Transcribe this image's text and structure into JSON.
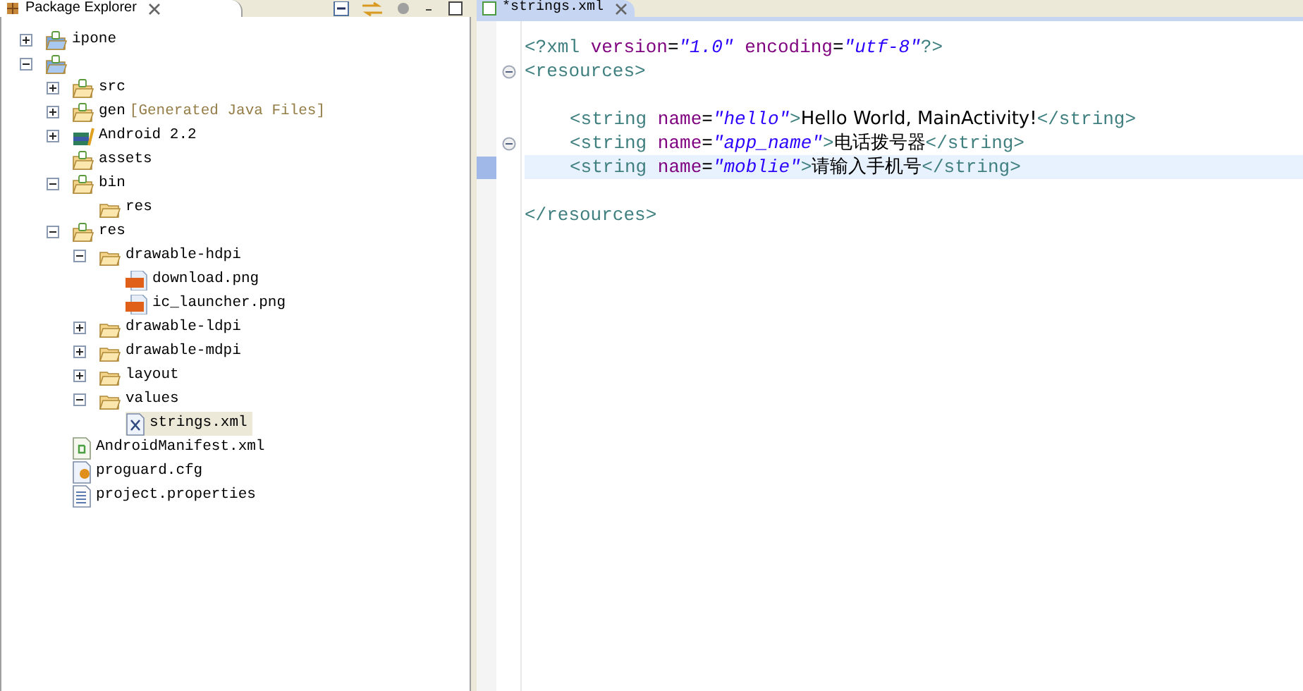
{
  "explorer": {
    "title": "Package Explorer",
    "tree": [
      {
        "label": "ipone",
        "kind": "project",
        "expanded": false,
        "selected": false
      },
      {
        "kind": "project",
        "expanded": true,
        "selected": false,
        "children": [
          {
            "label": "src",
            "kind": "source-folder",
            "expanded": false,
            "selected": false
          },
          {
            "label": "gen",
            "decoration": "[Generated Java Files]",
            "kind": "source-folder",
            "expanded": false,
            "selected": false
          },
          {
            "label": "Android 2.2",
            "kind": "library",
            "expanded": false,
            "selected": false
          },
          {
            "label": "assets",
            "kind": "source-folder",
            "selected": false
          },
          {
            "label": "bin",
            "kind": "source-folder",
            "expanded": true,
            "selected": false,
            "children": [
              {
                "label": "res",
                "kind": "folder",
                "selected": false
              }
            ]
          },
          {
            "label": "res",
            "kind": "source-folder",
            "expanded": true,
            "selected": false,
            "children": [
              {
                "label": "drawable-hdpi",
                "kind": "folder",
                "expanded": true,
                "selected": false,
                "children": [
                  {
                    "label": "download.png",
                    "kind": "png",
                    "selected": false
                  },
                  {
                    "label": "ic_launcher.png",
                    "kind": "png",
                    "selected": false
                  }
                ]
              },
              {
                "label": "drawable-ldpi",
                "kind": "folder",
                "expanded": false,
                "selected": false
              },
              {
                "label": "drawable-mdpi",
                "kind": "folder",
                "expanded": false,
                "selected": false
              },
              {
                "label": "layout",
                "kind": "folder",
                "expanded": false,
                "selected": false
              },
              {
                "label": "values",
                "kind": "folder",
                "expanded": true,
                "selected": false,
                "children": [
                  {
                    "label": "strings.xml",
                    "kind": "xml",
                    "selected": true
                  }
                ]
              }
            ]
          },
          {
            "label": "AndroidManifest.xml",
            "kind": "manifest",
            "selected": false
          },
          {
            "label": "proguard.cfg",
            "kind": "cfg",
            "selected": false
          },
          {
            "label": "project.properties",
            "kind": "properties",
            "selected": false
          }
        ]
      }
    ]
  },
  "editor": {
    "tab": {
      "title": "*strings.xml",
      "selected": true
    },
    "lines": [
      {
        "fold": false,
        "current": false,
        "indented": false,
        "tokens": [
          {
            "kind": "tag",
            "text": "<?xml"
          },
          {
            "kind": "attr",
            "text": " version"
          },
          {
            "kind": "punct",
            "text": "="
          },
          {
            "kind": "value",
            "text": "\"1.0\""
          },
          {
            "kind": "attr",
            "text": " encoding"
          },
          {
            "kind": "punct",
            "text": "="
          },
          {
            "kind": "value",
            "text": "\"utf-8\""
          },
          {
            "kind": "tag",
            "text": "?>"
          }
        ]
      },
      {
        "fold": true,
        "current": false,
        "indented": false,
        "tokens": [
          {
            "kind": "tag",
            "text": "<resources>"
          }
        ]
      },
      {
        "fold": false,
        "current": false
      },
      {
        "fold": false,
        "current": false,
        "indented": true,
        "tokens": [
          {
            "kind": "tag",
            "text": "<string"
          },
          {
            "kind": "attr",
            "text": " name"
          },
          {
            "kind": "punct",
            "text": "="
          },
          {
            "kind": "value",
            "text": "\"hello\""
          },
          {
            "kind": "tag",
            "text": ">"
          },
          {
            "kind": "text",
            "text": "Hello World, MainActivity!"
          },
          {
            "kind": "tag",
            "text": "</string>"
          }
        ]
      },
      {
        "fold": true,
        "current": false,
        "indented": true,
        "tokens": [
          {
            "kind": "tag",
            "text": "<string"
          },
          {
            "kind": "attr",
            "text": " name"
          },
          {
            "kind": "punct",
            "text": "="
          },
          {
            "kind": "value",
            "text": "\"app_name\""
          },
          {
            "kind": "tag",
            "text": ">"
          },
          {
            "kind": "text",
            "text": "电话拨号器"
          },
          {
            "kind": "tag",
            "text": "</string>"
          }
        ]
      },
      {
        "fold": false,
        "current": true,
        "indented": true,
        "tokens": [
          {
            "kind": "tag",
            "text": "<string"
          },
          {
            "kind": "attr",
            "text": " name"
          },
          {
            "kind": "punct",
            "text": "="
          },
          {
            "kind": "value",
            "text": "\"moblie\""
          },
          {
            "kind": "tag",
            "text": ">"
          },
          {
            "kind": "text",
            "text": "请输入手机号"
          },
          {
            "kind": "tag",
            "text": "</string>"
          }
        ]
      },
      {
        "fold": false,
        "current": false
      },
      {
        "fold": false,
        "current": false,
        "indented": false,
        "tokens": [
          {
            "kind": "tag",
            "text": "</resources>"
          }
        ]
      }
    ]
  }
}
